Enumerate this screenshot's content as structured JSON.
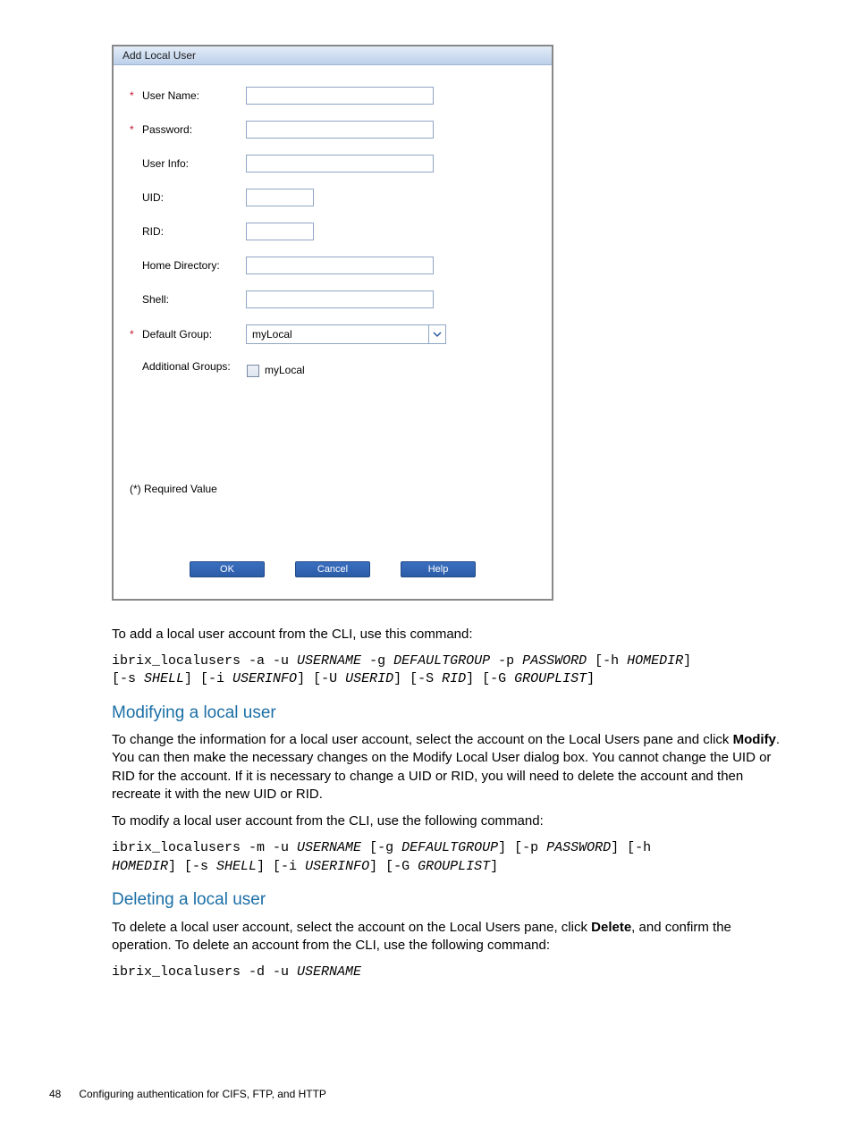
{
  "dialog": {
    "title": "Add Local User",
    "fields": {
      "username_label": "User Name:",
      "password_label": "Password:",
      "userinfo_label": "User Info:",
      "uid_label": "UID:",
      "rid_label": "RID:",
      "homedir_label": "Home Directory:",
      "shell_label": "Shell:",
      "defaultgroup_label": "Default Group:",
      "defaultgroup_value": "myLocal",
      "additionalgroups_label": "Additional Groups:",
      "additionalgroups_option": "myLocal"
    },
    "required_note": "(*) Required Value",
    "buttons": {
      "ok": "OK",
      "cancel": "Cancel",
      "help": "Help"
    }
  },
  "body": {
    "add_intro": "To add a local user account from the CLI, use this command:",
    "add_cmd_plain": "ibrix_localusers -a -u ",
    "add_cmd_arg1": "USERNAME",
    "add_cmd_p2": " -g ",
    "add_cmd_arg2": "DEFAULTGROUP",
    "add_cmd_p3": " -p ",
    "add_cmd_arg3": "PASSWORD",
    "add_cmd_p4": " [-h ",
    "add_cmd_arg4": "HOMEDIR",
    "add_cmd_p5": "]\n[-s ",
    "add_cmd_arg5": "SHELL",
    "add_cmd_p6": "] [-i ",
    "add_cmd_arg6": "USERINFO",
    "add_cmd_p7": "] [-U ",
    "add_cmd_arg7": "USERID",
    "add_cmd_p8": "] [-S ",
    "add_cmd_arg8": "RID",
    "add_cmd_p9": "] [-G ",
    "add_cmd_arg9": "GROUPLIST",
    "add_cmd_p10": "]",
    "modify_heading": "Modifying a local user",
    "modify_p_pre": "To change the information for a local user account, select the account on the Local Users pane and click ",
    "modify_bold": "Modify",
    "modify_p_post": ". You can then make the necessary changes on the Modify Local User dialog box. You cannot change the UID or RID for the account. If it is necessary to change a UID or RID, you will need to delete the account and then recreate it with the new UID or RID.",
    "modify_intro2": "To modify a local user account from the CLI, use the following command:",
    "mod_cmd_p1": "ibrix_localusers -m -u ",
    "mod_cmd_a1": "USERNAME",
    "mod_cmd_p2": " [-g ",
    "mod_cmd_a2": "DEFAULTGROUP",
    "mod_cmd_p3": "] [-p ",
    "mod_cmd_a3": "PASSWORD",
    "mod_cmd_p4": "] [-h\n",
    "mod_cmd_a4": "HOMEDIR",
    "mod_cmd_p5": "] [-s ",
    "mod_cmd_a5": "SHELL",
    "mod_cmd_p6": "] [-i ",
    "mod_cmd_a6": "USERINFO",
    "mod_cmd_p7": "] [-G ",
    "mod_cmd_a7": "GROUPLIST",
    "mod_cmd_p8": "]",
    "delete_heading": "Deleting a local user",
    "delete_p_pre": "To delete a local user account, select the account on the Local Users pane, click ",
    "delete_bold": "Delete",
    "delete_p_post": ", and confirm the operation. To delete an account from the CLI, use the following command:",
    "del_cmd_p1": "ibrix_localusers -d -u ",
    "del_cmd_a1": "USERNAME"
  },
  "footer": {
    "page_number": "48",
    "section_title": "Configuring authentication for CIFS, FTP, and HTTP"
  }
}
